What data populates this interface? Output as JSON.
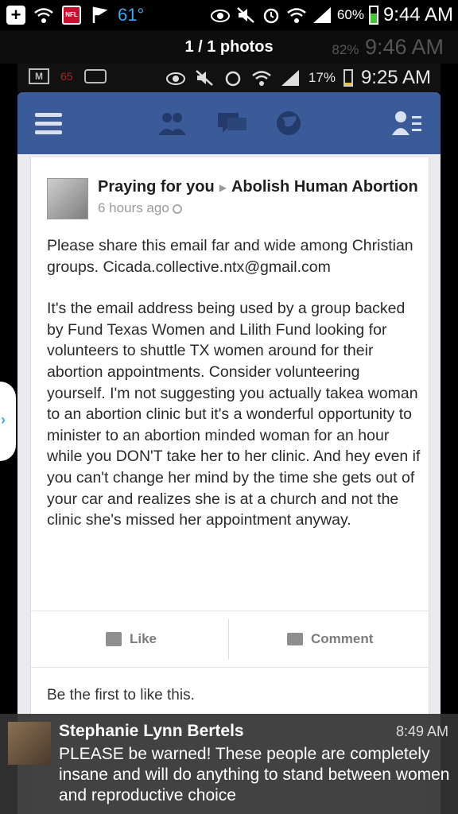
{
  "status_bar": {
    "temperature": "61°",
    "battery_percent": "60%",
    "battery_level": 0.6,
    "time": "9:44 AM",
    "nfl_label": "NFL"
  },
  "viewer": {
    "count_label": "1 / 1 photos"
  },
  "ghost_status": {
    "battery": "82%",
    "time": "9:46 AM"
  },
  "inner_status": {
    "gmail_label": "M",
    "badge_count": "65",
    "battery_percent": "17%",
    "battery_level": 0.17,
    "time": "9:25 AM"
  },
  "post": {
    "author": "Praying for you",
    "target": "Abolish Human Abortion",
    "time": "6 hours ago",
    "paragraph_1": "Please share this email far and wide among Christian groups.  Cicada.collective.ntx@gmail.com",
    "paragraph_2": "It's the email address being used by a group backed by Fund Texas Women and Lilith Fund looking for volunteers to shuttle TX women around for their abortion appointments.  Consider volunteering yourself.  I'm not suggesting you actually takea woman to an abortion clinic but it's a wonderful opportunity to minister to an abortion minded woman for an hour while you DON'T take her to her clinic.  And hey even if you can't change her mind by the time she gets out of your car and realizes she is at a church and not the clinic she's missed her appointment anyway.",
    "like_label": "Like",
    "comment_label": "Comment",
    "first_like": "Be the first to like this."
  },
  "notification": {
    "name": "Stephanie Lynn Bertels",
    "time": "8:49 AM",
    "message": "PLEASE be warned! These people are completely insane and will do anything to stand between women and reproductive choice"
  }
}
